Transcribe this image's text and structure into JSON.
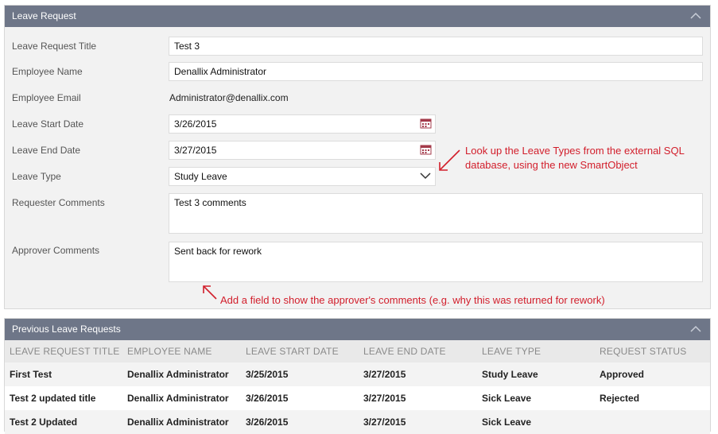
{
  "form": {
    "title": "Leave Request",
    "labels": {
      "title": "Leave Request Title",
      "name": "Employee Name",
      "email": "Employee Email",
      "start": "Leave Start Date",
      "end": "Leave End Date",
      "type": "Leave Type",
      "requester": "Requester Comments",
      "approver": "Approver Comments"
    },
    "values": {
      "title": "Test 3",
      "name": "Denallix Administrator",
      "email": "Administrator@denallix.com",
      "start": "3/26/2015",
      "end": "3/27/2015",
      "type": "Study Leave",
      "requester": "Test 3 comments",
      "approver": "Sent back for rework"
    }
  },
  "annotations": {
    "leave_type_line1": "Look up the Leave Types from the external SQL",
    "leave_type_line2": "database, using the new SmartObject",
    "approver": "Add a field to show the approver's comments (e.g. why this was returned for rework)"
  },
  "previous": {
    "title": "Previous Leave Requests",
    "columns": [
      "LEAVE REQUEST TITLE",
      "EMPLOYEE NAME",
      "LEAVE START DATE",
      "LEAVE END DATE",
      "LEAVE TYPE",
      "REQUEST STATUS"
    ],
    "rows": [
      [
        "First Test",
        "Denallix Administrator",
        "3/25/2015",
        "3/27/2015",
        "Study Leave",
        "Approved"
      ],
      [
        "Test 2 updated title",
        "Denallix Administrator",
        "3/26/2015",
        "3/27/2015",
        "Sick Leave",
        "Rejected"
      ],
      [
        "Test 2 Updated",
        "Denallix Administrator",
        "3/26/2015",
        "3/27/2015",
        "Sick Leave",
        ""
      ]
    ]
  },
  "colors": {
    "header": "#6e7688",
    "annotation": "#d21e2b",
    "panel": "#f2f2f2"
  },
  "icons": [
    "chevron-up-icon",
    "calendar-icon",
    "chevron-down-icon"
  ]
}
